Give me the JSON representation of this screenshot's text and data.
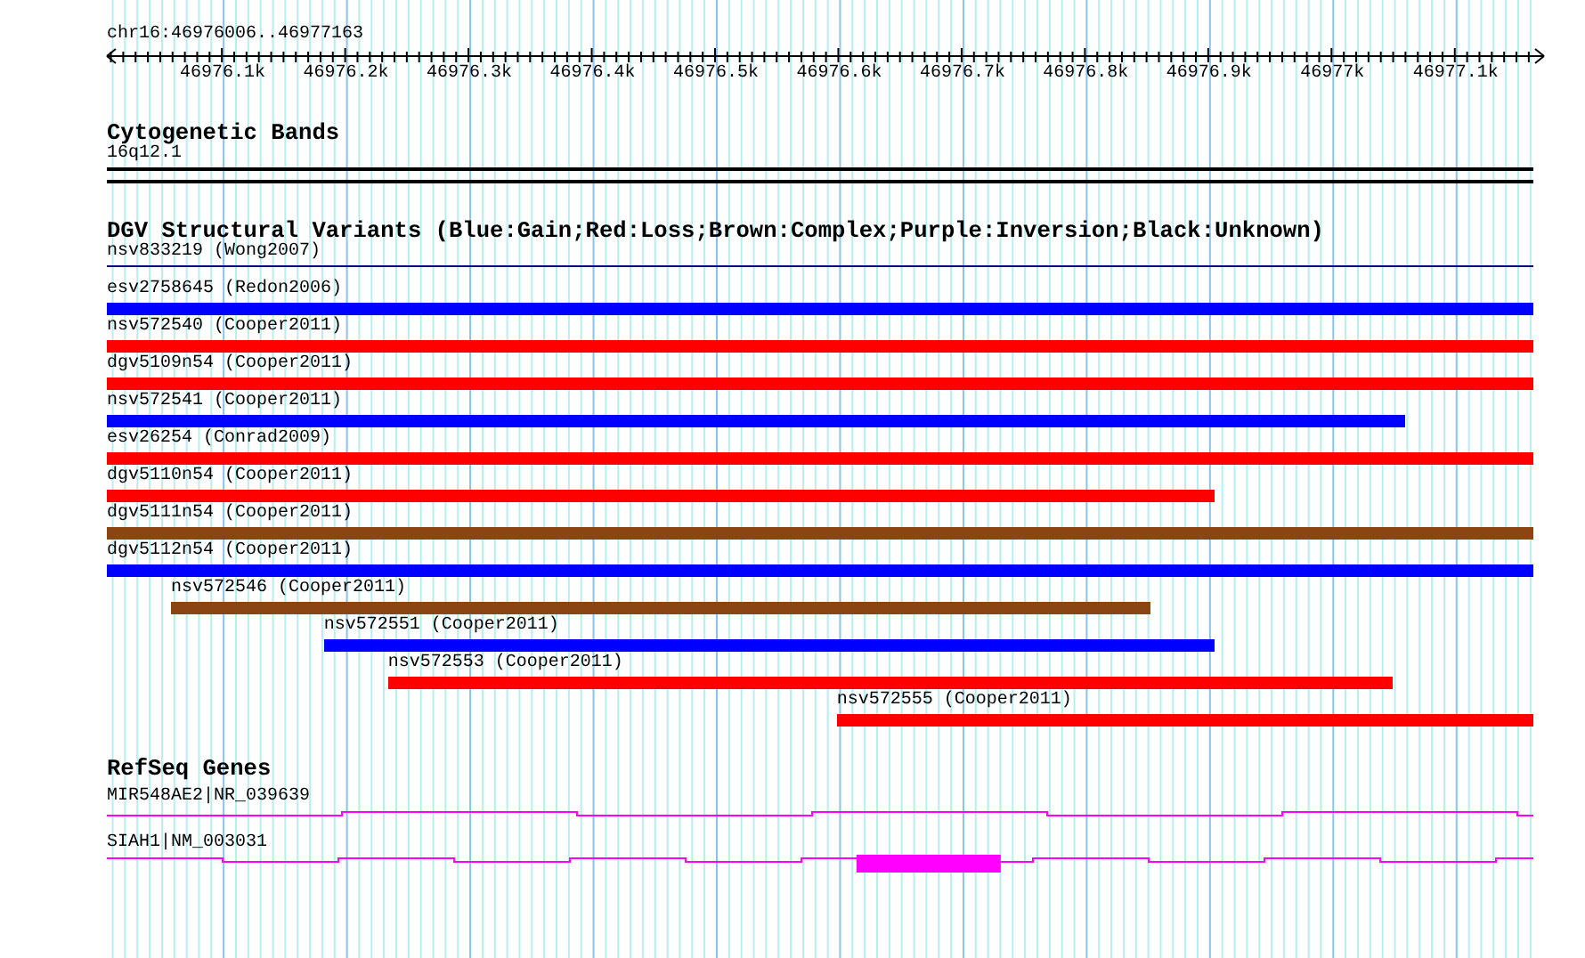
{
  "location": "chr16:46976006..46977163",
  "ruler": {
    "ticks": [
      {
        "label": "46976.1k"
      },
      {
        "label": "46976.2k"
      },
      {
        "label": "46976.3k"
      },
      {
        "label": "46976.4k"
      },
      {
        "label": "46976.5k"
      },
      {
        "label": "46976.6k"
      },
      {
        "label": "46976.7k"
      },
      {
        "label": "46976.8k"
      },
      {
        "label": "46976.9k"
      },
      {
        "label": "46977k"
      },
      {
        "label": "46977.1k"
      }
    ]
  },
  "cytogenetic_bands": {
    "title": "Cytogenetic Bands",
    "band": "16q12.1"
  },
  "structural_variants": {
    "title": "DGV Structural Variants (Blue:Gain;Red:Loss;Brown:Complex;Purple:Inversion;Black:Unknown)",
    "features": [
      {
        "label": "nsv833219 (Wong2007)",
        "kind": "line",
        "color": "#000080"
      },
      {
        "label": "esv2758645 (Redon2006)",
        "kind": "bar",
        "color": "#0000ff"
      },
      {
        "label": "nsv572540 (Cooper2011)",
        "kind": "bar",
        "color": "#ff0000"
      },
      {
        "label": "dgv5109n54 (Cooper2011)",
        "kind": "bar",
        "color": "#ff0000"
      },
      {
        "label": "nsv572541 (Cooper2011)",
        "kind": "bar",
        "color": "#0000ff"
      },
      {
        "label": "esv26254 (Conrad2009)",
        "kind": "bar",
        "color": "#ff0000"
      },
      {
        "label": "dgv5110n54 (Cooper2011)",
        "kind": "bar",
        "color": "#ff0000"
      },
      {
        "label": "dgv5111n54 (Cooper2011)",
        "kind": "bar",
        "color": "#8b4513"
      },
      {
        "label": "dgv5112n54 (Cooper2011)",
        "kind": "bar",
        "color": "#0000ff"
      },
      {
        "label": "nsv572546 (Cooper2011)",
        "kind": "bar",
        "color": "#8b4513"
      },
      {
        "label": "nsv572551 (Cooper2011)",
        "kind": "bar",
        "color": "#0000ff"
      },
      {
        "label": "nsv572553 (Cooper2011)",
        "kind": "bar",
        "color": "#ff0000"
      },
      {
        "label": "nsv572555 (Cooper2011)",
        "kind": "bar",
        "color": "#ff0000"
      }
    ]
  },
  "refseq_genes": {
    "title": "RefSeq Genes",
    "genes": [
      {
        "label": "MIR548AE2|NR_039639"
      },
      {
        "label": "SIAH1|NM_003031"
      }
    ]
  }
}
